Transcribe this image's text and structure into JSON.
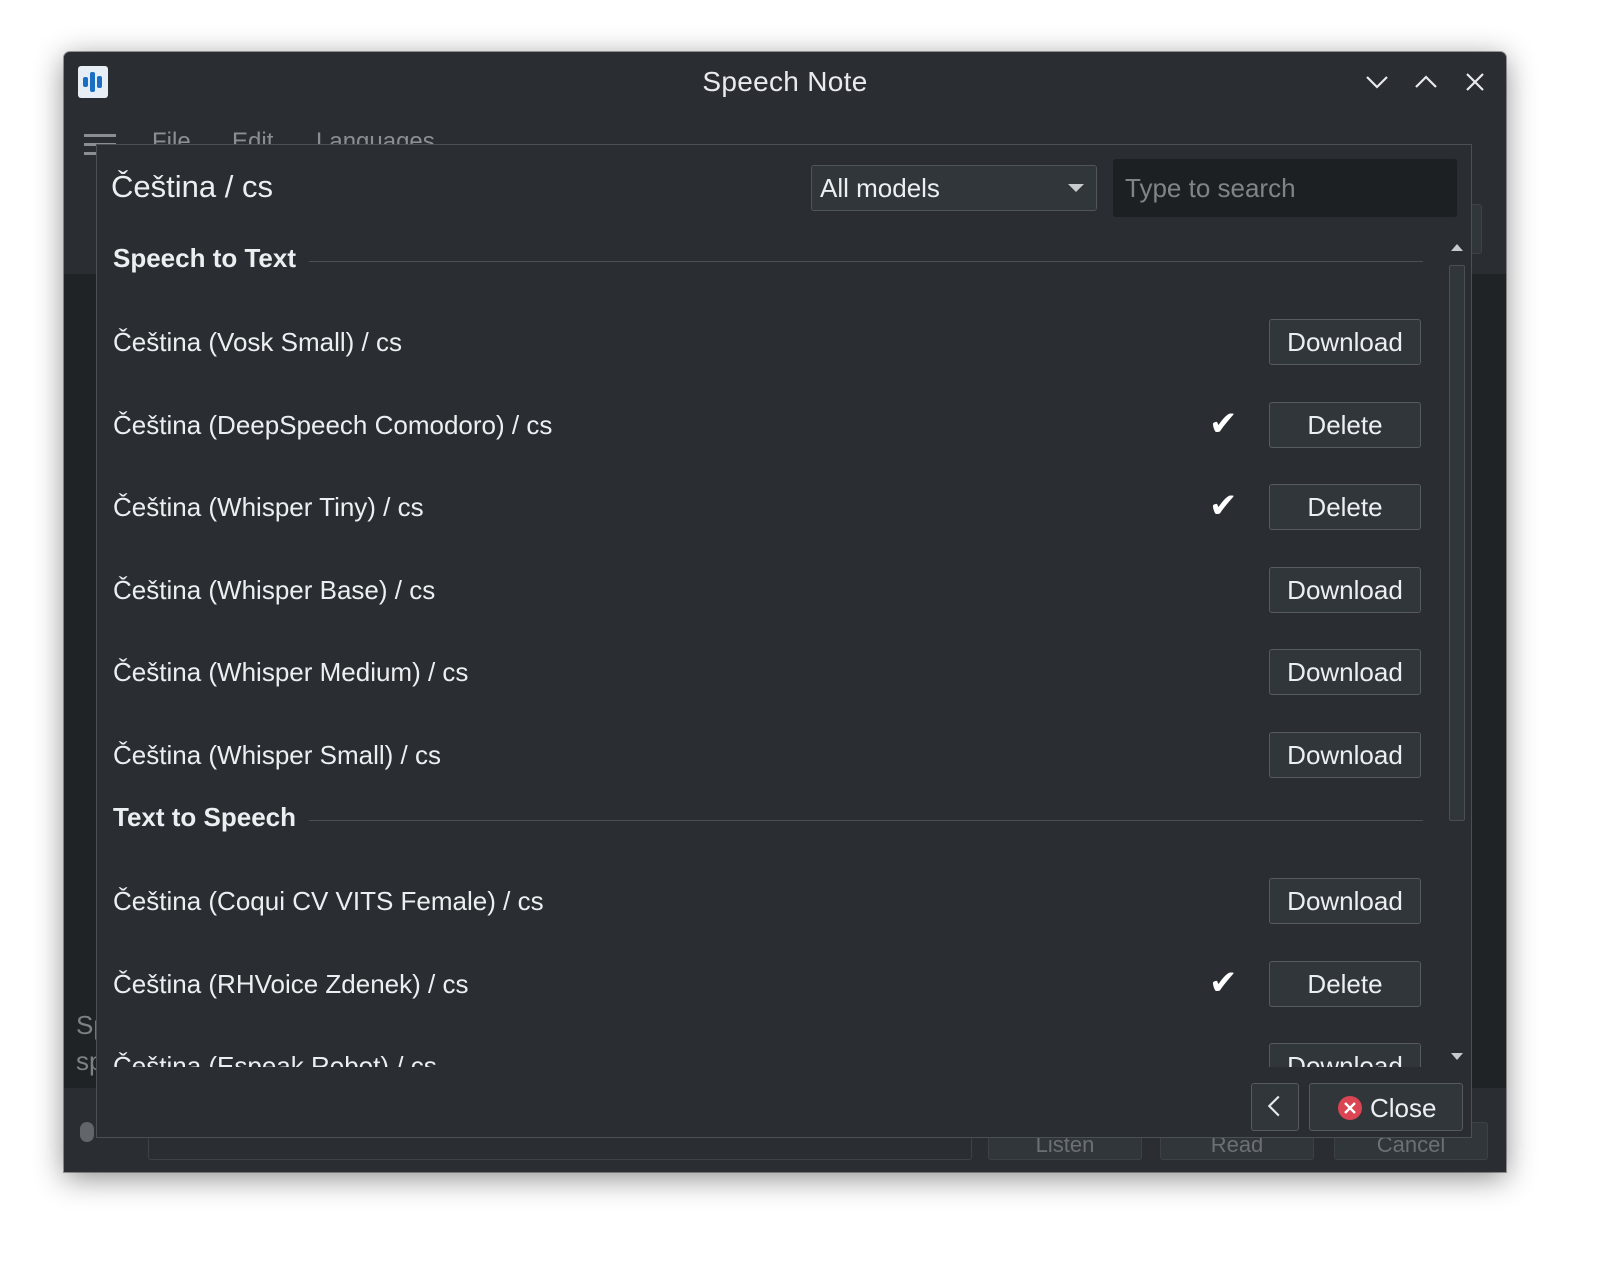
{
  "window": {
    "title": "Speech Note",
    "app_icon": "speech-note-app-icon"
  },
  "background": {
    "menu": [
      "File",
      "Edit",
      "Languages"
    ],
    "text_lines": [
      "Sp",
      "sp"
    ],
    "buttons": [
      "Listen",
      "Read",
      "Cancel"
    ]
  },
  "dialog": {
    "title": "Čeština / cs",
    "filter": {
      "selected": "All models"
    },
    "search": {
      "placeholder": "Type to search"
    },
    "sections": [
      {
        "header": "Speech to Text",
        "models": [
          {
            "name": "Čeština (Vosk Small) / cs",
            "installed": false,
            "action": "Download"
          },
          {
            "name": "Čeština (DeepSpeech Comodoro) / cs",
            "installed": true,
            "action": "Delete"
          },
          {
            "name": "Čeština (Whisper Tiny) / cs",
            "installed": true,
            "action": "Delete"
          },
          {
            "name": "Čeština (Whisper Base) / cs",
            "installed": false,
            "action": "Download"
          },
          {
            "name": "Čeština (Whisper Medium) / cs",
            "installed": false,
            "action": "Download"
          },
          {
            "name": "Čeština (Whisper Small) / cs",
            "installed": false,
            "action": "Download"
          }
        ]
      },
      {
        "header": "Text to Speech",
        "models": [
          {
            "name": "Čeština (Coqui CV VITS Female) / cs",
            "installed": false,
            "action": "Download"
          },
          {
            "name": "Čeština (RHVoice Zdenek) / cs",
            "installed": true,
            "action": "Delete"
          },
          {
            "name": "Čeština (Espeak Robot) / cs",
            "installed": false,
            "action": "Download"
          }
        ]
      }
    ],
    "check_glyph": "✔",
    "close_label": "Close"
  },
  "colors": {
    "accent_close": "#da4453",
    "background": "#2a2e32",
    "text": "#eceff1"
  }
}
